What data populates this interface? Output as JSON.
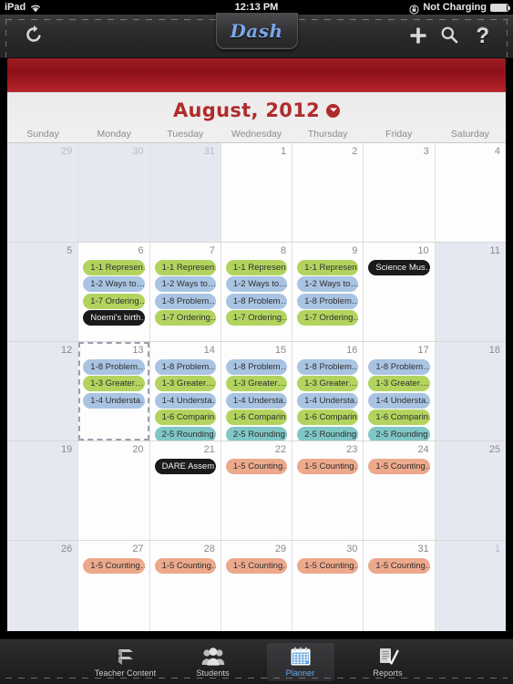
{
  "statusbar": {
    "device": "iPad",
    "wifi_icon": "wifi-icon",
    "time": "12:13 PM",
    "lock_icon": "rotation-lock-icon",
    "battery_label": "Not Charging",
    "battery_icon": "battery-icon"
  },
  "navbar": {
    "app_title": "Dash",
    "refresh_icon": "refresh-icon",
    "add_icon": "plus-icon",
    "search_icon": "search-icon",
    "help_icon": "question-mark-icon"
  },
  "calendar": {
    "month_title": "August, 2012",
    "month_dropdown_icon": "chevron-down-circle-icon",
    "accent_color": "#b12b2b",
    "weekdays": [
      "Sunday",
      "Monday",
      "Tuesday",
      "Wednesday",
      "Thursday",
      "Friday",
      "Saturday"
    ],
    "event_colors": {
      "green": "#b2d45f",
      "blue": "#a9c4e2",
      "teal": "#7fc7c6",
      "salmon": "#eda98c",
      "black": "#1a1a1a"
    },
    "weeks": [
      [
        {
          "day": "29",
          "out": true,
          "events": []
        },
        {
          "day": "30",
          "out": true,
          "events": []
        },
        {
          "day": "31",
          "out": true,
          "events": []
        },
        {
          "day": "1",
          "out": false,
          "events": []
        },
        {
          "day": "2",
          "out": false,
          "events": []
        },
        {
          "day": "3",
          "out": false,
          "events": []
        },
        {
          "day": "4",
          "out": false,
          "events": []
        }
      ],
      [
        {
          "day": "5",
          "out": false,
          "weekend": true,
          "events": []
        },
        {
          "day": "6",
          "out": false,
          "events": [
            {
              "label": "1-1 Represen…",
              "color": "green"
            },
            {
              "label": "1-2 Ways to…",
              "color": "blue"
            },
            {
              "label": "1-7 Ordering…",
              "color": "green"
            },
            {
              "label": "Noemi's birth…",
              "color": "black"
            }
          ]
        },
        {
          "day": "7",
          "out": false,
          "events": [
            {
              "label": "1-1 Represen…",
              "color": "green"
            },
            {
              "label": "1-2 Ways to…",
              "color": "blue"
            },
            {
              "label": "1-8 Problem…",
              "color": "blue"
            },
            {
              "label": "1-7 Ordering…",
              "color": "green"
            }
          ]
        },
        {
          "day": "8",
          "out": false,
          "events": [
            {
              "label": "1-1 Represen…",
              "color": "green"
            },
            {
              "label": "1-2 Ways to…",
              "color": "blue"
            },
            {
              "label": "1-8 Problem…",
              "color": "blue"
            },
            {
              "label": "1-7 Ordering…",
              "color": "green"
            }
          ]
        },
        {
          "day": "9",
          "out": false,
          "events": [
            {
              "label": "1-1 Represen…",
              "color": "green"
            },
            {
              "label": "1-2 Ways to…",
              "color": "blue"
            },
            {
              "label": "1-8 Problem…",
              "color": "blue"
            },
            {
              "label": "1-7 Ordering…",
              "color": "green"
            }
          ]
        },
        {
          "day": "10",
          "out": false,
          "events": [
            {
              "label": "Science Mus…",
              "color": "black"
            }
          ]
        },
        {
          "day": "11",
          "out": false,
          "weekend": true,
          "events": []
        }
      ],
      [
        {
          "day": "12",
          "out": false,
          "weekend": true,
          "events": []
        },
        {
          "day": "13",
          "out": false,
          "today": true,
          "events": [
            {
              "label": "1-8 Problem…",
              "color": "blue"
            },
            {
              "label": "1-3 Greater…",
              "color": "green"
            },
            {
              "label": "1-4 Understa…",
              "color": "blue"
            }
          ]
        },
        {
          "day": "14",
          "out": false,
          "events": [
            {
              "label": "1-8 Problem…",
              "color": "blue"
            },
            {
              "label": "1-3 Greater…",
              "color": "green"
            },
            {
              "label": "1-4 Understa…",
              "color": "blue"
            },
            {
              "label": "1-6 Comparin…",
              "color": "green"
            },
            {
              "label": "2-5 Rounding",
              "color": "teal"
            }
          ]
        },
        {
          "day": "15",
          "out": false,
          "events": [
            {
              "label": "1-8 Problem…",
              "color": "blue"
            },
            {
              "label": "1-3 Greater…",
              "color": "green"
            },
            {
              "label": "1-4 Understa…",
              "color": "blue"
            },
            {
              "label": "1-6 Comparin…",
              "color": "green"
            },
            {
              "label": "2-5 Rounding",
              "color": "teal"
            }
          ]
        },
        {
          "day": "16",
          "out": false,
          "events": [
            {
              "label": "1-8 Problem…",
              "color": "blue"
            },
            {
              "label": "1-3 Greater…",
              "color": "green"
            },
            {
              "label": "1-4 Understa…",
              "color": "blue"
            },
            {
              "label": "1-6 Comparin…",
              "color": "green"
            },
            {
              "label": "2-5 Rounding",
              "color": "teal"
            }
          ]
        },
        {
          "day": "17",
          "out": false,
          "events": [
            {
              "label": "1-8 Problem…",
              "color": "blue"
            },
            {
              "label": "1-3 Greater…",
              "color": "green"
            },
            {
              "label": "1-4 Understa…",
              "color": "blue"
            },
            {
              "label": "1-6 Comparin…",
              "color": "green"
            },
            {
              "label": "2-5 Rounding",
              "color": "teal"
            }
          ]
        },
        {
          "day": "18",
          "out": false,
          "weekend": true,
          "events": []
        }
      ],
      [
        {
          "day": "19",
          "out": false,
          "weekend": true,
          "events": []
        },
        {
          "day": "20",
          "out": false,
          "events": []
        },
        {
          "day": "21",
          "out": false,
          "events": [
            {
              "label": "DARE Assem…",
              "color": "black"
            }
          ]
        },
        {
          "day": "22",
          "out": false,
          "events": [
            {
              "label": "1-5 Counting…",
              "color": "salmon"
            }
          ]
        },
        {
          "day": "23",
          "out": false,
          "events": [
            {
              "label": "1-5 Counting…",
              "color": "salmon"
            }
          ]
        },
        {
          "day": "24",
          "out": false,
          "events": [
            {
              "label": "1-5 Counting…",
              "color": "salmon"
            }
          ]
        },
        {
          "day": "25",
          "out": false,
          "weekend": true,
          "events": []
        }
      ],
      [
        {
          "day": "26",
          "out": false,
          "weekend": true,
          "events": []
        },
        {
          "day": "27",
          "out": false,
          "events": [
            {
              "label": "1-5 Counting…",
              "color": "salmon"
            }
          ]
        },
        {
          "day": "28",
          "out": false,
          "events": [
            {
              "label": "1-5 Counting…",
              "color": "salmon"
            }
          ]
        },
        {
          "day": "29",
          "out": false,
          "events": [
            {
              "label": "1-5 Counting…",
              "color": "salmon"
            }
          ]
        },
        {
          "day": "30",
          "out": false,
          "events": [
            {
              "label": "1-5 Counting…",
              "color": "salmon"
            }
          ]
        },
        {
          "day": "31",
          "out": false,
          "events": [
            {
              "label": "1-5 Counting…",
              "color": "salmon"
            }
          ]
        },
        {
          "day": "1",
          "out": true,
          "weekend": true,
          "events": []
        }
      ]
    ]
  },
  "tabbar": {
    "active_color": "#6fa9e8",
    "tabs": [
      {
        "label": "Teacher Content",
        "icon": "book-stack-icon",
        "active": false
      },
      {
        "label": "Students",
        "icon": "people-icon",
        "active": false
      },
      {
        "label": "Planner",
        "icon": "calendar-icon",
        "active": true
      },
      {
        "label": "Reports",
        "icon": "document-check-icon",
        "active": false
      }
    ]
  }
}
